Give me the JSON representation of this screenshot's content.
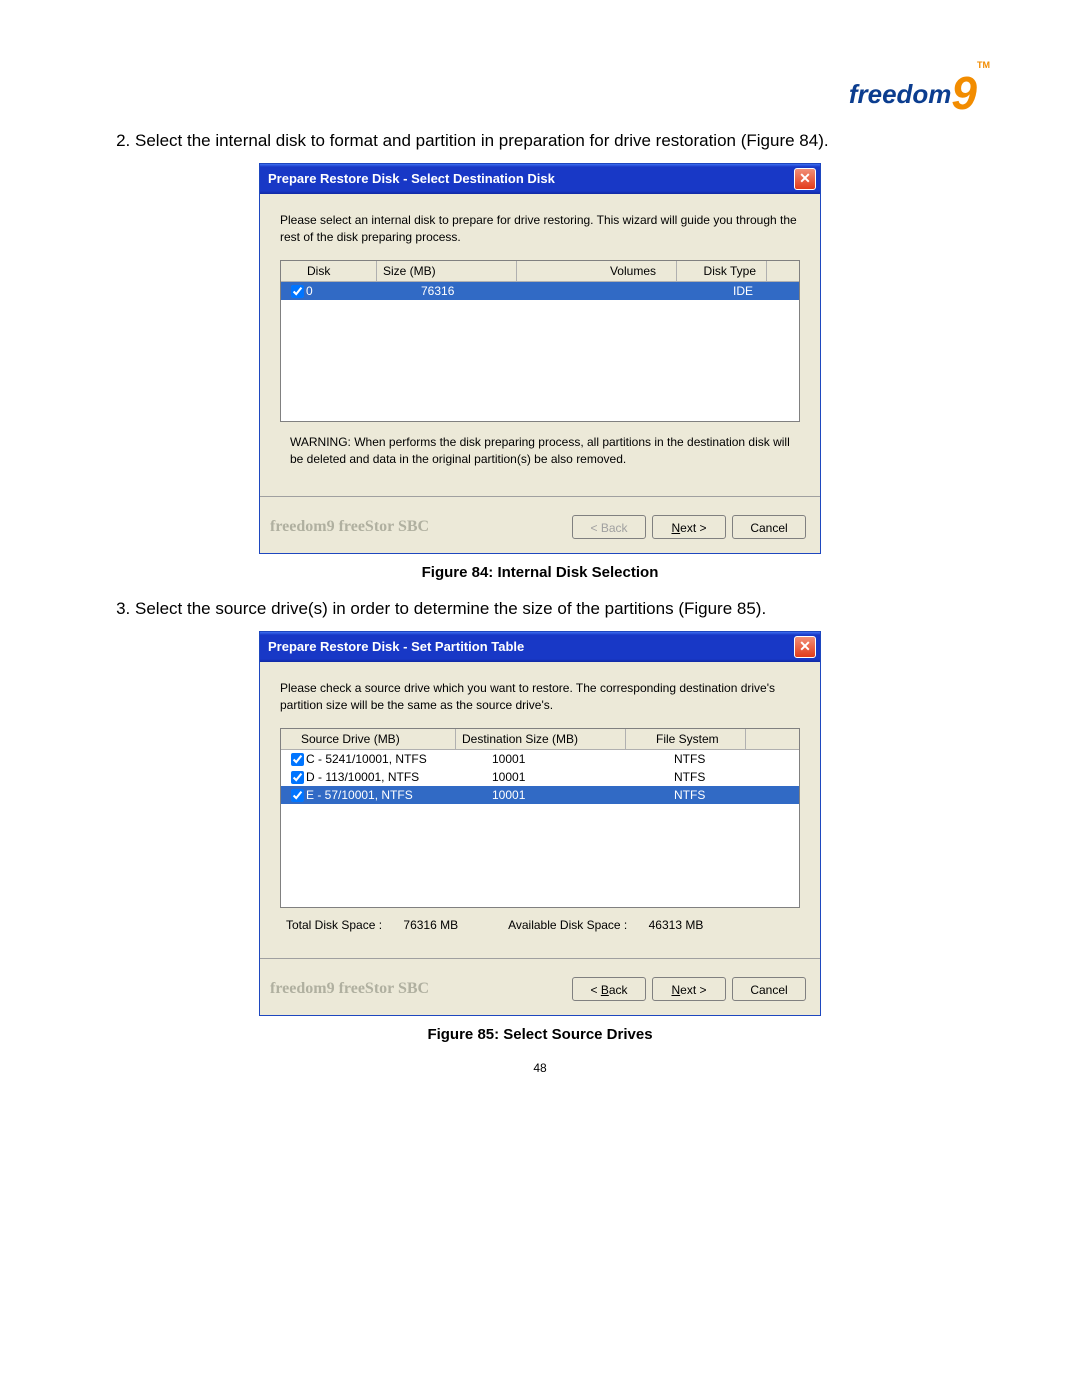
{
  "logo": {
    "text": "freedom",
    "nine": "9",
    "tm": "TM"
  },
  "step2": "Select the internal disk to format and partition in preparation for drive restoration (Figure 84).",
  "step3": "Select the source drive(s) in order to determine the size of the partitions (Figure 85).",
  "dialog1": {
    "title": "Prepare Restore Disk - Select Destination Disk",
    "instruction": "Please select an internal disk to prepare for drive restoring. This wizard will guide you through the rest of the disk preparing process.",
    "columns": {
      "disk": "Disk",
      "size": "Size (MB)",
      "volumes": "Volumes",
      "type": "Disk Type"
    },
    "row": {
      "checked": true,
      "disk": "0",
      "size": "76316",
      "volumes": "",
      "type": "IDE"
    },
    "warning": "WARNING: When performs the disk preparing process, all partitions in the destination disk will be deleted and data in the original partition(s) be also removed.",
    "brand": "freedom9 freeStor SBC",
    "buttons": {
      "back": "< Back",
      "next": "Next >",
      "cancel": "Cancel"
    }
  },
  "caption1": "Figure 84: Internal Disk Selection",
  "dialog2": {
    "title": "Prepare Restore Disk - Set Partition Table",
    "instruction": "Please check a source drive which you want to restore. The corresponding destination drive's partition size will be the same as the source drive's.",
    "columns": {
      "src": "Source Drive (MB)",
      "dest": "Destination Size (MB)",
      "fs": "File System"
    },
    "rows": [
      {
        "checked": true,
        "selected": false,
        "src": "C - 5241/10001, NTFS",
        "dest": "10001",
        "fs": "NTFS"
      },
      {
        "checked": true,
        "selected": false,
        "src": "D - 113/10001, NTFS",
        "dest": "10001",
        "fs": "NTFS"
      },
      {
        "checked": true,
        "selected": true,
        "src": "E - 57/10001, NTFS",
        "dest": "10001",
        "fs": "NTFS"
      }
    ],
    "totals": {
      "totalLabel": "Total Disk Space :",
      "totalValue": "76316 MB",
      "availLabel": "Available Disk Space :",
      "availValue": "46313 MB"
    },
    "brand": "freedom9 freeStor SBC",
    "buttons": {
      "back": "< Back",
      "next": "Next >",
      "cancel": "Cancel"
    }
  },
  "caption2": "Figure 85: Select Source Drives",
  "pageNumber": "48"
}
